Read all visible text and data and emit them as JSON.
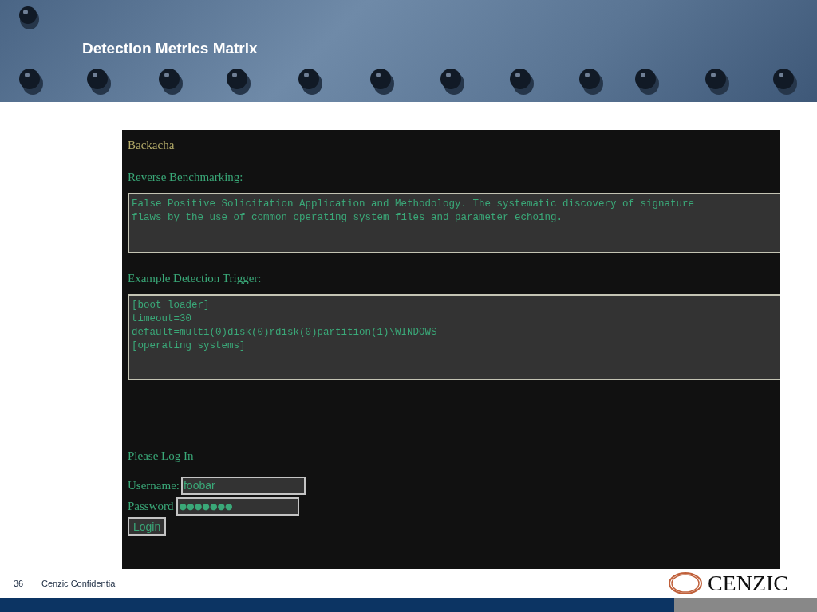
{
  "slide": {
    "title": "Detection Metrics Matrix",
    "page_number": "36",
    "footer": "Cenzic Confidential",
    "logo": "CENZIC"
  },
  "screenshot": {
    "site_title": "Backacha",
    "sections": [
      {
        "heading": "Reverse Benchmarking:",
        "lines": [
          "False Positive Solicitation Application and Methodology. The systematic discovery of signature",
          "flaws by the use of common operating system files and parameter echoing."
        ]
      },
      {
        "heading": "Example Detection Trigger:",
        "lines": [
          "[boot loader]",
          "timeout=30",
          "default=multi(0)disk(0)rdisk(0)partition(1)\\WINDOWS",
          "[operating systems]"
        ]
      }
    ],
    "login": {
      "heading": "Please Log In",
      "username_label": "Username:",
      "username": "foobar",
      "password_label": "Password",
      "password": "●●●●●●●",
      "button": "Login"
    }
  }
}
